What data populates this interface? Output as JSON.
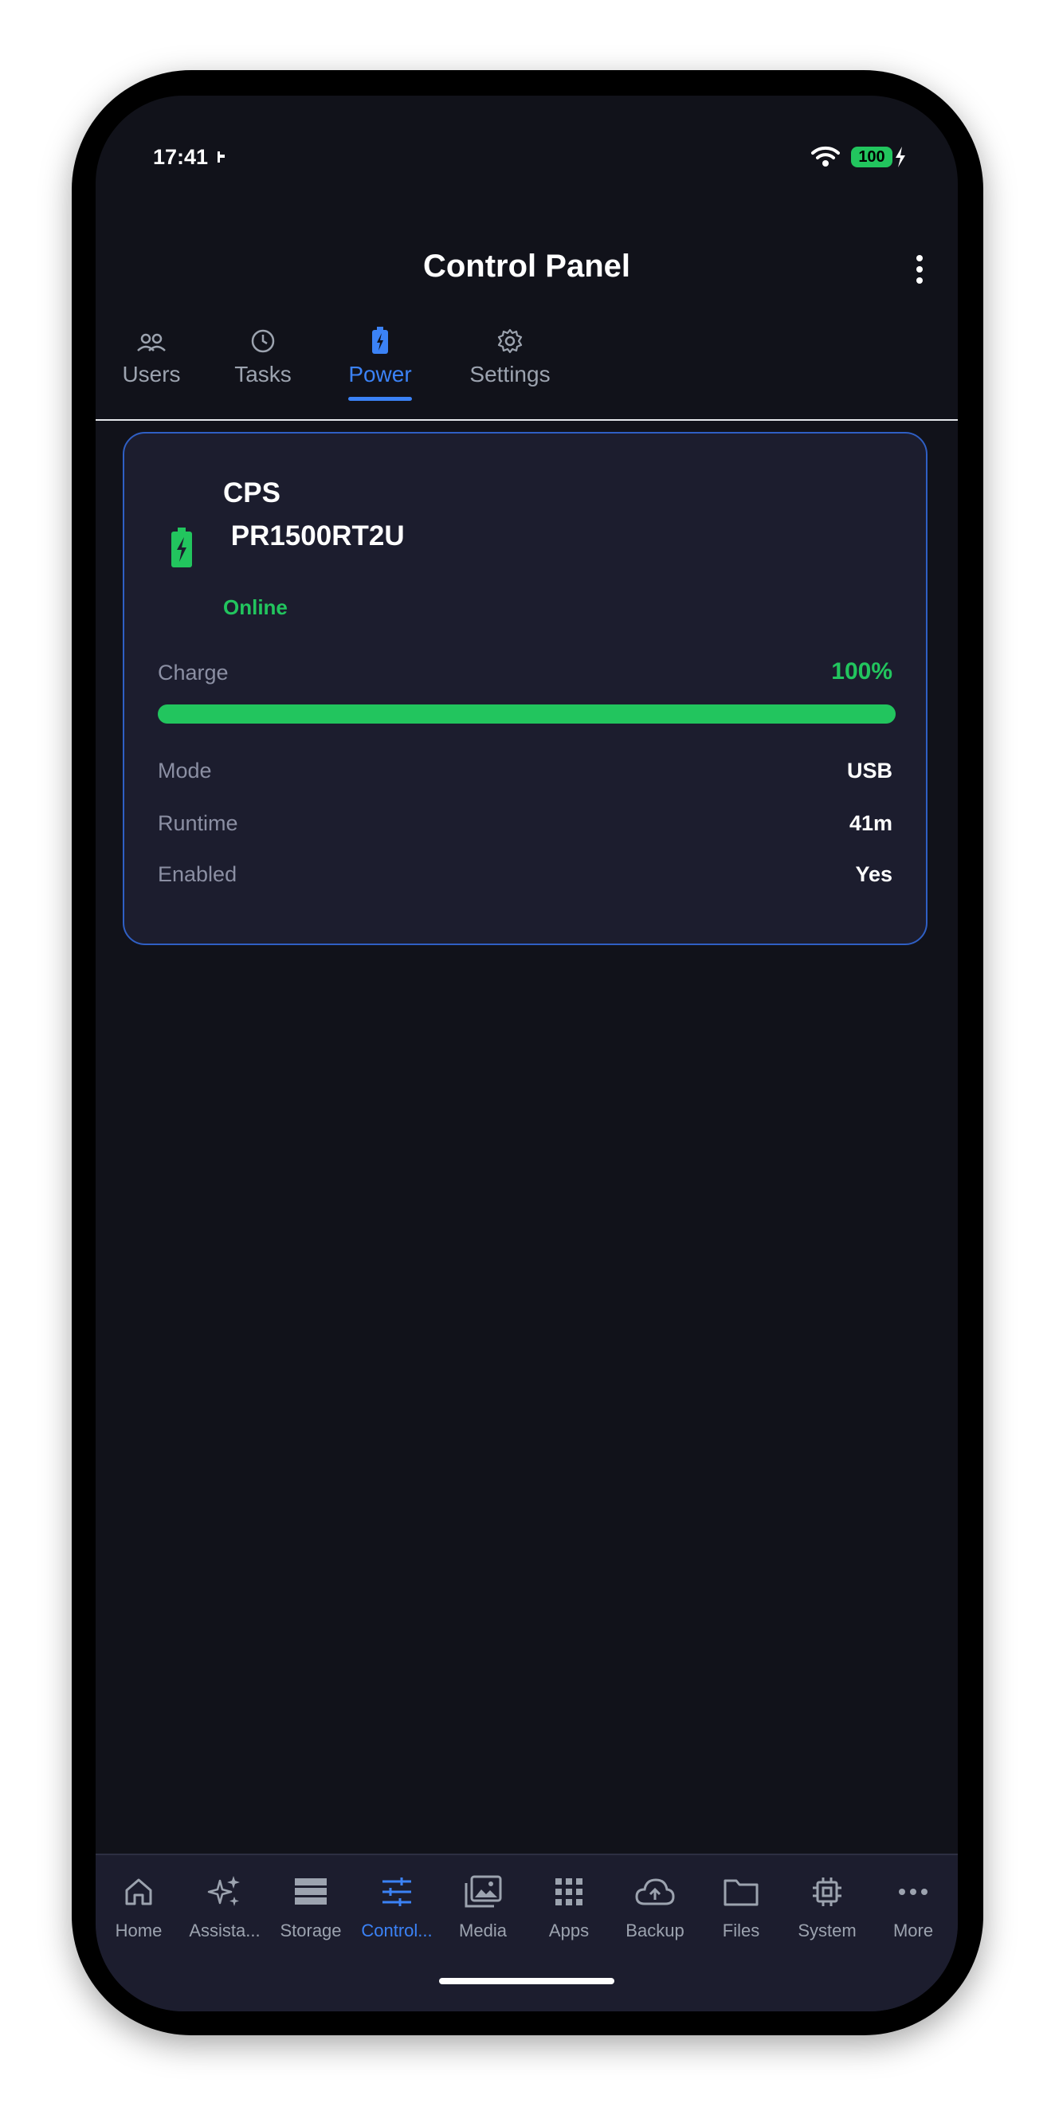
{
  "status_bar": {
    "time": "17:41",
    "battery": "100"
  },
  "header": {
    "title": "Control Panel",
    "menu_icon": "more-vert-icon"
  },
  "tabs": [
    {
      "label": "Users",
      "icon": "users-icon"
    },
    {
      "label": "Tasks",
      "icon": "clock-icon"
    },
    {
      "label": "Power",
      "icon": "battery-icon",
      "active": true
    },
    {
      "label": "Settings",
      "icon": "gear-icon"
    }
  ],
  "ups": {
    "name": "CPS\n PR1500RT2U",
    "status": "Online",
    "charge_label": "Charge",
    "charge_value": "100%",
    "charge_fraction": 1.0,
    "rows": [
      {
        "label": "Mode",
        "value": "USB"
      },
      {
        "label": "Runtime",
        "value": "41m"
      },
      {
        "label": "Enabled",
        "value": "Yes"
      }
    ]
  },
  "bottom_nav": [
    {
      "label": "Home",
      "icon": "home-icon"
    },
    {
      "label": "Assista...",
      "icon": "sparkles-icon"
    },
    {
      "label": "Storage",
      "icon": "storage-icon"
    },
    {
      "label": "Control...",
      "icon": "sliders-icon",
      "active": true
    },
    {
      "label": "Media",
      "icon": "media-icon"
    },
    {
      "label": "Apps",
      "icon": "apps-grid-icon"
    },
    {
      "label": "Backup",
      "icon": "cloud-upload-icon"
    },
    {
      "label": "Files",
      "icon": "folder-icon"
    },
    {
      "label": "System",
      "icon": "chip-icon"
    },
    {
      "label": "More",
      "icon": "more-horiz-icon"
    }
  ],
  "colors": {
    "accent": "#3b82f6",
    "success": "#22c55e",
    "background": "#11121a",
    "card": "#1c1d2e"
  }
}
